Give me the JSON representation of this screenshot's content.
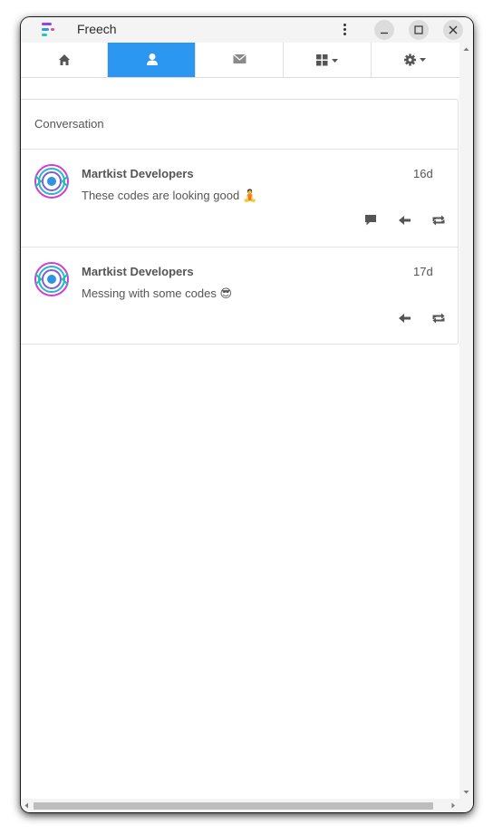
{
  "window": {
    "title": "Freech",
    "controls": [
      "kebab-menu-icon",
      "minimize-icon",
      "maximize-icon",
      "close-icon"
    ]
  },
  "navbar": {
    "tabs": [
      {
        "id": "home",
        "icon": "home-icon",
        "active": false
      },
      {
        "id": "profile",
        "icon": "user-icon",
        "active": true
      },
      {
        "id": "messages",
        "icon": "envelope-icon",
        "active": false
      },
      {
        "id": "apps",
        "icon": "grid-icon",
        "dropdown": true,
        "active": false
      },
      {
        "id": "settings",
        "icon": "gear-icon",
        "dropdown": true,
        "active": false
      }
    ],
    "active_color": "#2b97f0"
  },
  "conversation": {
    "title": "Conversation",
    "posts": [
      {
        "author": "Martkist Developers",
        "time": "16d",
        "text": "These codes are looking good 🧘",
        "actions": [
          "comment-icon",
          "reply-icon",
          "repost-icon"
        ]
      },
      {
        "author": "Martkist Developers",
        "time": "17d",
        "text": "Messing with some codes 😎",
        "actions": [
          "reply-icon",
          "repost-icon"
        ]
      }
    ]
  }
}
